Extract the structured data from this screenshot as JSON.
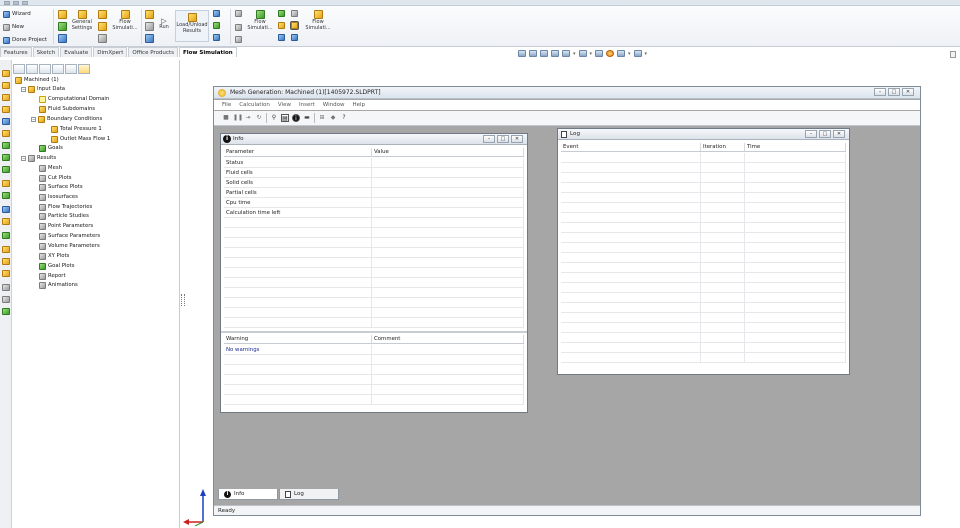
{
  "ribbon": {
    "wizard": "Wizard",
    "new": "New",
    "done_project": "Done Project",
    "general_settings": "General Settings",
    "flow_simulation_1": "Flow Simulati...",
    "run": "Run",
    "load_unload_results": "Load/Unload Results",
    "flow_simulation_2": "Flow Simulati...",
    "flow_simulation_3": "Flow Simulati..."
  },
  "tabs": [
    "Features",
    "Sketch",
    "Evaluate",
    "DimXpert",
    "Office Products",
    "Flow Simulation"
  ],
  "active_tab": "Flow Simulation",
  "tree": {
    "root": "Machined (1)",
    "input_data": "Input Data",
    "computational_domain": "Computational Domain",
    "fluid_subdomains": "Fluid Subdomains",
    "boundary_conditions": "Boundary Conditions",
    "total_pressure": "Total Pressure 1",
    "outlet_mass_flow": "Outlet Mass Flow 1",
    "goals": "Goals",
    "results": "Results",
    "mesh": "Mesh",
    "cut_plots": "Cut Plots",
    "surface_plots": "Surface Plots",
    "isosurfaces": "Isosurfaces",
    "flow_trajectories": "Flow Trajectories",
    "particle_studies": "Particle Studies",
    "point_parameters": "Point Parameters",
    "surface_parameters": "Surface Parameters",
    "volume_parameters": "Volume Parameters",
    "xy_plots": "XY Plots",
    "goal_plots": "Goal Plots",
    "report": "Report",
    "animations": "Animations"
  },
  "mesh_window": {
    "title": "Mesh Generation: Machined (1)[1405972.SLDPRT]",
    "menu": [
      "File",
      "Calculation",
      "View",
      "Insert",
      "Window",
      "Help"
    ],
    "info": {
      "title": "Info",
      "columns": [
        "Parameter",
        "Value"
      ],
      "rows": [
        "Status",
        "Fluid cells",
        "Solid cells",
        "Partial cells",
        "Cpu time",
        "Calculation time left"
      ],
      "warning_columns": [
        "Warning",
        "Comment"
      ],
      "warning_text": "No warnings"
    },
    "log": {
      "title": "Log",
      "columns": [
        "Event",
        "Iteration",
        "Time"
      ]
    },
    "bottom_tabs": [
      "Info",
      "Log"
    ],
    "status": "Ready"
  },
  "colors": {
    "warning_text": "#1c2a8f",
    "mdi_background": "#a6a6a6"
  }
}
